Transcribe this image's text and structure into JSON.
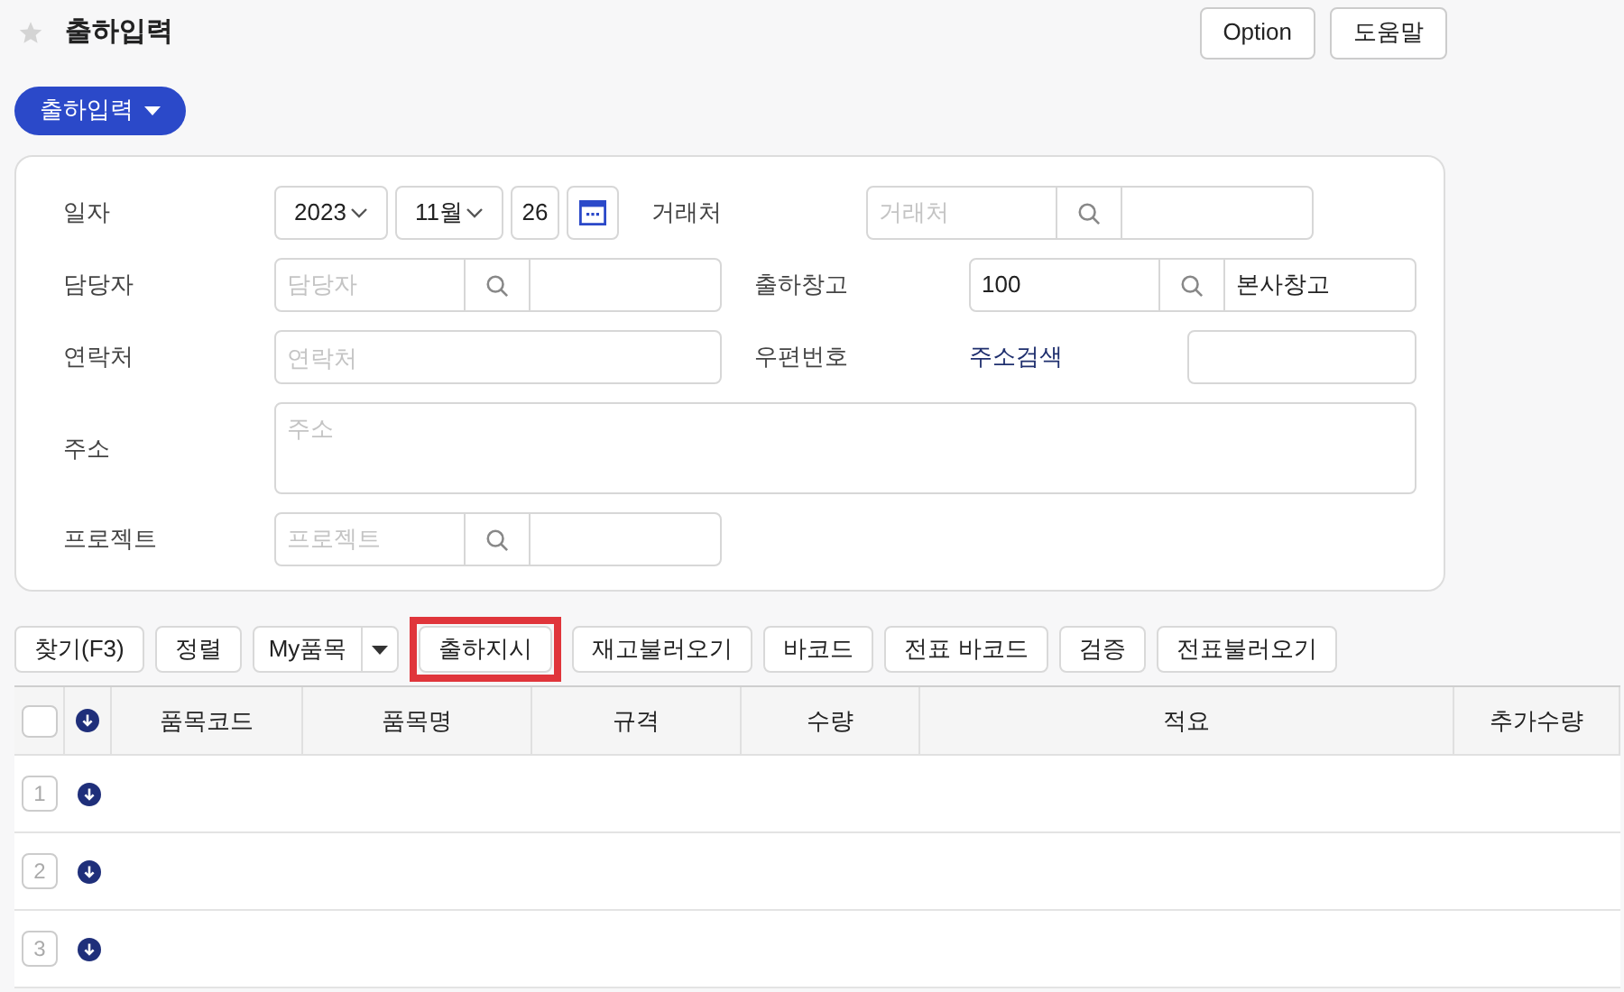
{
  "page": {
    "title": "출하입력"
  },
  "header_buttons": [
    "Option",
    "도움말"
  ],
  "menu_button": {
    "label": "출하입력"
  },
  "form": {
    "rows": [
      [
        {
          "kind": "date",
          "label": "일자",
          "year": "2023",
          "month": "11월",
          "day": "26"
        },
        {
          "kind": "lookup",
          "label": "거래처",
          "placeholder": "거래처"
        }
      ],
      [
        {
          "kind": "lookup",
          "label": "담당자",
          "placeholder": "담당자"
        },
        {
          "kind": "lookup",
          "label": "출하창고",
          "value": "100",
          "name": "본사창고"
        }
      ],
      [
        {
          "kind": "text",
          "label": "연락처",
          "placeholder": "연락처"
        },
        {
          "kind": "zip",
          "label": "우편번호",
          "link": "주소검색"
        }
      ],
      [
        {
          "kind": "textarea",
          "label": "주소",
          "placeholder": "주소"
        }
      ],
      [
        {
          "kind": "lookup",
          "label": "프로젝트",
          "placeholder": "프로젝트"
        }
      ]
    ]
  },
  "toolbar": [
    {
      "kind": "button",
      "label": "찾기(F3)",
      "highlighted": false
    },
    {
      "kind": "button",
      "label": "정렬",
      "highlighted": false
    },
    {
      "kind": "split",
      "label": "My품목",
      "highlighted": false
    },
    {
      "kind": "button",
      "label": "출하지시",
      "highlighted": true
    },
    {
      "kind": "button",
      "label": "재고불러오기",
      "highlighted": false
    },
    {
      "kind": "button",
      "label": "바코드",
      "highlighted": false
    },
    {
      "kind": "button",
      "label": "전표 바코드",
      "highlighted": false
    },
    {
      "kind": "button",
      "label": "검증",
      "highlighted": false
    },
    {
      "kind": "button",
      "label": "전표불러오기",
      "highlighted": false
    }
  ],
  "table": {
    "select_all": {
      "checked": false
    },
    "columns": [
      "품목코드",
      "품목명",
      "규격",
      "수량",
      "적요",
      "추가수량"
    ],
    "rows": [
      {
        "number": "1"
      },
      {
        "number": "2"
      },
      {
        "number": "3"
      }
    ]
  }
}
